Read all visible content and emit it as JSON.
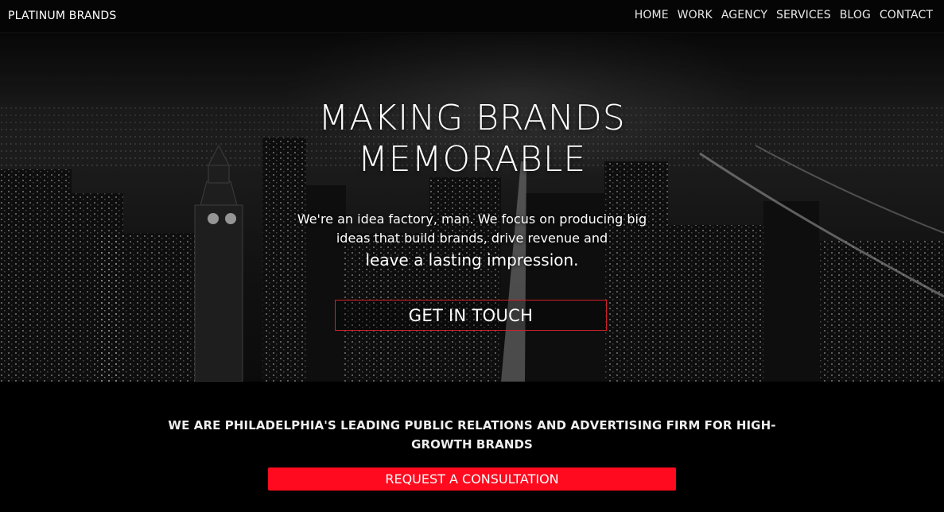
{
  "nav": {
    "brand": "PLATINUM BRANDS",
    "links": [
      "HOME",
      "WORK",
      "AGENCY",
      "SERVICES",
      "BLOG",
      "CONTACT"
    ]
  },
  "hero": {
    "headline_line1": "MAKING BRANDS",
    "headline_line2": "MEMORABLE",
    "lead_line1": "We're an idea factory, man. We focus on producing big",
    "lead_line2": "ideas that build brands, drive revenue and",
    "lead_line3": "leave a lasting impression.",
    "cta_label": "GET IN TOUCH"
  },
  "section": {
    "tagline": "WE ARE PHILADELPHIA'S LEADING PUBLIC RELATIONS AND ADVERTISING FIRM FOR HIGH-GROWTH BRANDS",
    "cta_label": "REQUEST A CONSULTATION"
  },
  "colors": {
    "accent": "#ff0a1e",
    "outline": "#d0202a",
    "background": "#000000"
  }
}
